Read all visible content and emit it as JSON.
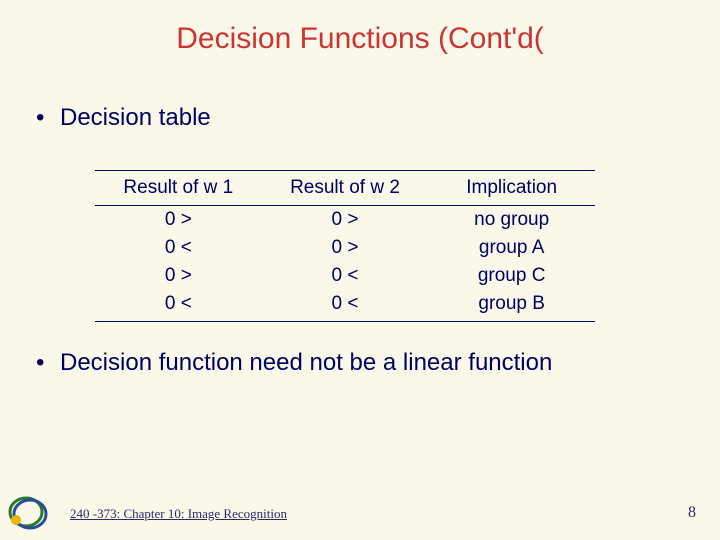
{
  "title": "Decision Functions (Cont'd(",
  "bullets": [
    "Decision table",
    "Decision function need not be a linear function"
  ],
  "table": {
    "headers": [
      "Result of w 1",
      "Result of w 2",
      "Implication"
    ],
    "rows": [
      [
        "0 >",
        "0 >",
        "no group"
      ],
      [
        "0 <",
        "0 >",
        "group A"
      ],
      [
        "0 >",
        "0 <",
        "group C"
      ],
      [
        "0 <",
        "0 <",
        "group B"
      ]
    ]
  },
  "footer": "240 -373: Chapter 10: Image Recognition",
  "page": "8"
}
